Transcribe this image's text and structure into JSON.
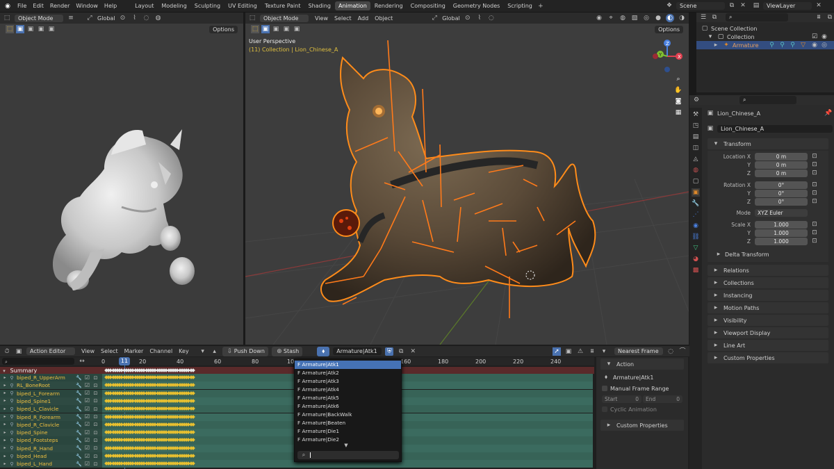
{
  "menu": [
    "File",
    "Edit",
    "Render",
    "Window",
    "Help"
  ],
  "workspaces": [
    "Layout",
    "Modeling",
    "Sculpting",
    "UV Editing",
    "Texture Paint",
    "Shading",
    "Animation",
    "Rendering",
    "Compositing",
    "Geometry Nodes",
    "Scripting"
  ],
  "active_workspace": "Animation",
  "scene": "Scene",
  "view_layer": "ViewLayer",
  "left_view": {
    "mode": "Object Mode",
    "orientation": "Global",
    "options": "Options"
  },
  "main_view": {
    "mode": "Object Mode",
    "menus": [
      "View",
      "Select",
      "Add",
      "Object"
    ],
    "orientation": "Global",
    "options": "Options",
    "info_title": "User Perspective",
    "info_sub": "(11) Collection | Lion_Chinese_A"
  },
  "outliner": {
    "scene_collection": "Scene Collection",
    "collection": "Collection",
    "armature": "Armature"
  },
  "properties": {
    "object_name": "Lion_Chinese_A",
    "object_field": "Lion_Chinese_A",
    "transform": "Transform",
    "location_label": "Location X",
    "loc": [
      "0 m",
      "0 m",
      "0 m"
    ],
    "rotation_label": "Rotation X",
    "rot": [
      "0°",
      "0°",
      "0°"
    ],
    "mode_label": "Mode",
    "mode_value": "XYZ Euler",
    "scale_label": "Scale X",
    "scale": [
      "1.000",
      "1.000",
      "1.000"
    ],
    "y": "Y",
    "z": "Z",
    "delta": "Delta Transform",
    "sections": [
      "Relations",
      "Collections",
      "Instancing",
      "Motion Paths",
      "Visibility",
      "Viewport Display",
      "Line Art",
      "Custom Properties"
    ]
  },
  "dopesheet": {
    "editor": "Action Editor",
    "menus": [
      "View",
      "Select",
      "Marker",
      "Channel",
      "Key"
    ],
    "push_down": "Push Down",
    "stash": "Stash",
    "action": "Armature|Atk1",
    "snap": "Nearest Frame",
    "frame_ticks": [
      "0",
      "20",
      "40",
      "60",
      "80",
      "100",
      "160",
      "180",
      "200",
      "220",
      "240"
    ],
    "current_frame": "11",
    "summary": "Summary",
    "channels": [
      "biped_R_UpperArm",
      "RL_BoneRoot",
      "biped_L_Forearm",
      "biped_Spine1",
      "biped_L_Clavicle",
      "biped_R_Forearm",
      "biped_R_Clavicle",
      "biped_Spine",
      "biped_Footsteps",
      "biped_R_Hand",
      "biped_Head",
      "biped_L_Hand"
    ]
  },
  "action_menu": {
    "items": [
      "F Armature|Atk1",
      "F Armature|Atk2",
      "F Armature|Atk3",
      "F Armature|Atk4",
      "F Armature|Atk5",
      "F Armature|Atk6",
      "F Armature|BackWalk",
      "F Armature|Beaten",
      "F Armature|Die1",
      "F Armature|Die2"
    ],
    "selected": 0
  },
  "action_panel": {
    "tab": "Action",
    "action_name": "Armature|Atk1",
    "manual": "Manual Frame Range",
    "start_label": "Start",
    "start_value": "0",
    "end_label": "End",
    "end_value": "0",
    "cyclic": "Cyclic Animation",
    "custom": "Custom Properties"
  }
}
